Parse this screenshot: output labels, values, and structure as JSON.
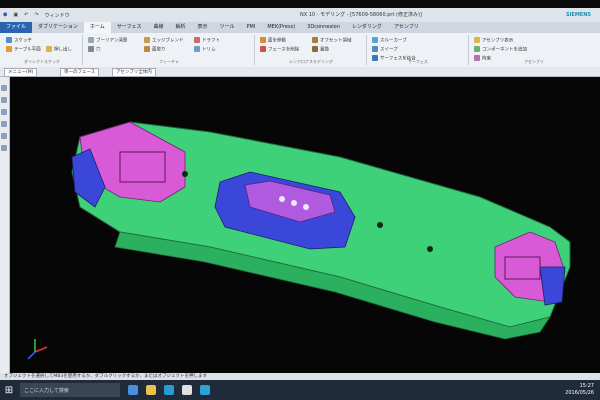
{
  "title_bar": {
    "window_menu": "ウィンドウ",
    "title": "NX 10 - モデリング - [57609-58060.prt (修正済み)]",
    "brand": "SIEMENS"
  },
  "tabs": [
    {
      "label": "ファイル"
    },
    {
      "label": "ダブリケーション"
    },
    {
      "label": "ホーム",
      "active": true
    },
    {
      "label": "サーフェス"
    },
    {
      "label": "曲線"
    },
    {
      "label": "解析"
    },
    {
      "label": "表示"
    },
    {
      "label": "ツール"
    },
    {
      "label": "PMI"
    },
    {
      "label": "MEK(Press)"
    },
    {
      "label": "3Dconnexion"
    },
    {
      "label": "レンダリング"
    },
    {
      "label": "アセンブリ"
    }
  ],
  "ribbon": {
    "groups": [
      {
        "label": "ダイレクトスケッチ",
        "buttons": [
          "スケッチ",
          "テーブル平面",
          "押し出し"
        ]
      },
      {
        "label": "フィーチャ",
        "buttons": [
          "ブーリアン演算",
          "穴",
          "エッジブレンド",
          "面取り",
          "ドラフト",
          "トリム"
        ]
      },
      {
        "label": "シンクロナスモデリング",
        "buttons": [
          "面を移動",
          "フェースを削除",
          "オフセット領域",
          "置換"
        ]
      },
      {
        "label": "サーフェス",
        "buttons": [
          "スルーカーブ",
          "スイープ",
          "サーフェスを結合"
        ]
      },
      {
        "label": "アセンブリ",
        "buttons": [
          "アセンブリ表示",
          "コンポーネントを追加",
          "拘束"
        ]
      }
    ]
  },
  "toolbar2": {
    "filter_label": "単一のフェース",
    "selection_label": "アセンブリ全体内",
    "menu_label": "メニュー(M)"
  },
  "status": {
    "message": "オブジェクトを選択してMB3を使用するか、ダブルクリックするか、またはオブジェクトを押します"
  },
  "taskbar": {
    "search_placeholder": "ここに入力して検索",
    "time": "15:27",
    "date": "2016/05/26"
  },
  "colors": {
    "base_part": "#3fd07a",
    "purple_part": "#d85ad6",
    "blue_part": "#3b47d8",
    "background": "#060606"
  }
}
